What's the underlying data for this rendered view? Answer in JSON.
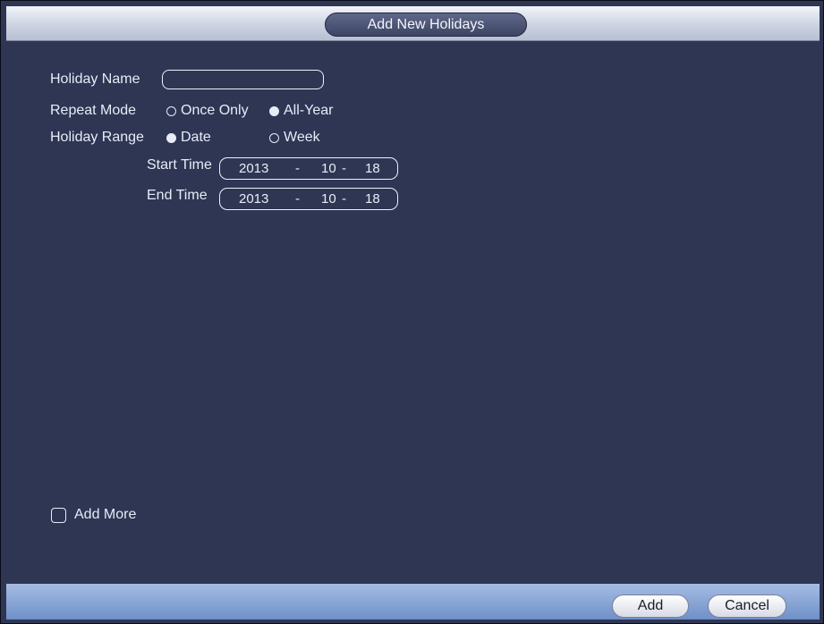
{
  "dialog": {
    "title": "Add New Holidays"
  },
  "form": {
    "holiday_name_label": "Holiday Name",
    "holiday_name_value": "",
    "repeat_mode_label": "Repeat Mode",
    "repeat_mode_options": [
      "Once Only",
      "All-Year"
    ],
    "repeat_mode_selected": "All-Year",
    "holiday_range_label": "Holiday Range",
    "holiday_range_options": [
      "Date",
      "Week"
    ],
    "holiday_range_selected": "Date",
    "start_time_label": "Start Time",
    "start_time": {
      "year": "2013",
      "month": "10",
      "day": "18"
    },
    "end_time_label": "End Time",
    "end_time": {
      "year": "2013",
      "month": "10",
      "day": "18"
    },
    "date_separator": "-"
  },
  "add_more": {
    "label": "Add More",
    "checked": false
  },
  "buttons": {
    "add": "Add",
    "cancel": "Cancel"
  }
}
